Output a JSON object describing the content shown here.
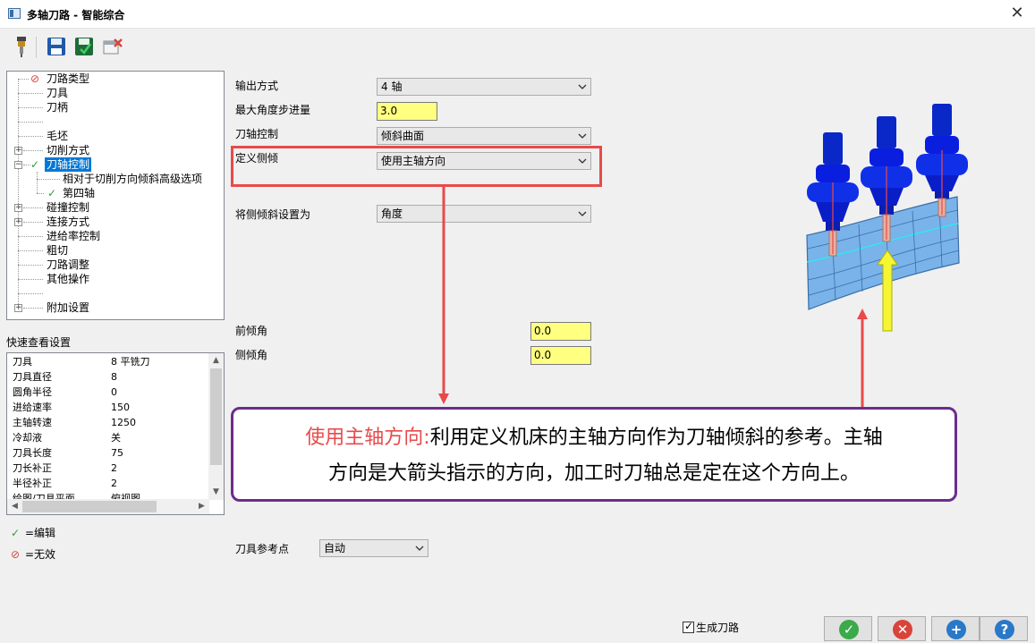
{
  "window": {
    "title": "多轴刀路 - 智能综合"
  },
  "toolbar": {
    "items": [
      "tool-holder-icon",
      "save-icon",
      "save-as-icon",
      "delete-icon"
    ]
  },
  "tree": {
    "items": [
      {
        "label": "刀路类型",
        "state": "invalid",
        "expandable": false,
        "selected": false
      },
      {
        "label": "刀具",
        "state": "",
        "expandable": false,
        "selected": false
      },
      {
        "label": "刀柄",
        "state": "",
        "expandable": false,
        "selected": false
      },
      {
        "label": "",
        "state": "",
        "expandable": false,
        "selected": false
      },
      {
        "label": "毛坯",
        "state": "",
        "expandable": false,
        "selected": false
      },
      {
        "label": "切削方式",
        "state": "",
        "expandable": true,
        "expanded": false,
        "selected": false
      },
      {
        "label": "刀轴控制",
        "state": "edited",
        "expandable": true,
        "expanded": true,
        "selected": true
      },
      {
        "label": "相对于切削方向倾斜高级选项",
        "state": "",
        "expandable": false,
        "selected": false
      },
      {
        "label": "第四轴",
        "state": "edited",
        "expandable": false,
        "selected": false
      },
      {
        "label": "碰撞控制",
        "state": "",
        "expandable": true,
        "expanded": false,
        "selected": false
      },
      {
        "label": "连接方式",
        "state": "",
        "expandable": true,
        "expanded": false,
        "selected": false
      },
      {
        "label": "进给率控制",
        "state": "",
        "expandable": false,
        "selected": false
      },
      {
        "label": "粗切",
        "state": "",
        "expandable": false,
        "selected": false
      },
      {
        "label": "刀路调整",
        "state": "",
        "expandable": false,
        "selected": false
      },
      {
        "label": "其他操作",
        "state": "",
        "expandable": false,
        "selected": false
      },
      {
        "label": "",
        "state": "",
        "expandable": false,
        "selected": false
      },
      {
        "label": "附加设置",
        "state": "",
        "expandable": true,
        "expanded": false,
        "selected": false
      }
    ]
  },
  "quick_view": {
    "title": "快速查看设置",
    "rows": [
      {
        "key": "刀具",
        "value": "8 平铣刀"
      },
      {
        "key": "刀具直径",
        "value": "8"
      },
      {
        "key": "圆角半径",
        "value": "0"
      },
      {
        "key": "进给速率",
        "value": "150"
      },
      {
        "key": "主轴转速",
        "value": "1250"
      },
      {
        "key": "冷却液",
        "value": "关"
      },
      {
        "key": "刀具长度",
        "value": "75"
      },
      {
        "key": "刀长补正",
        "value": "2"
      },
      {
        "key": "半径补正",
        "value": "2"
      },
      {
        "key": "绘图/刀具平面",
        "value": "俯视图"
      }
    ]
  },
  "legend": {
    "edited": "=编辑",
    "invalid": "=无效"
  },
  "form": {
    "output_mode": {
      "label": "输出方式",
      "value": "4 轴"
    },
    "max_angle_step": {
      "label": "最大角度步进量",
      "value": "3.0"
    },
    "tool_axis_control": {
      "label": "刀轴控制",
      "value": "倾斜曲面"
    },
    "define_side_tilt": {
      "label": "定义侧倾",
      "value": "使用主轴方向"
    },
    "set_side_tilt_to": {
      "label": "将侧倾斜设置为",
      "value": "角度"
    },
    "lead_angle": {
      "label": "前倾角",
      "value": "0.0"
    },
    "side_angle": {
      "label": "侧倾角",
      "value": "0.0"
    },
    "tool_ref_point": {
      "label": "刀具参考点",
      "value": "自动"
    }
  },
  "callout": {
    "highlight": "使用主轴方向:",
    "line1": "利用定义机床的主轴方向作为刀轴倾斜的参考。主轴",
    "line2": "方向是大箭头指示的方向，加工时刀轴总是定在这个方向上。"
  },
  "footer": {
    "generate_toolpath": "生成刀路",
    "buttons": [
      {
        "name": "ok-button",
        "icon": "check-icon",
        "color": "#3aaa4a"
      },
      {
        "name": "cancel-button",
        "icon": "x-icon",
        "color": "#d9443a"
      },
      {
        "name": "add-button",
        "icon": "plus-icon",
        "color": "#2a78c8"
      },
      {
        "name": "help-button",
        "icon": "question-icon",
        "color": "#2a78c8"
      }
    ]
  },
  "colors": {
    "accent": "#0078d7",
    "highlight_red": "#e84a4a",
    "callout_border": "#6b2d8c",
    "input_yellow": "#ffff80"
  }
}
